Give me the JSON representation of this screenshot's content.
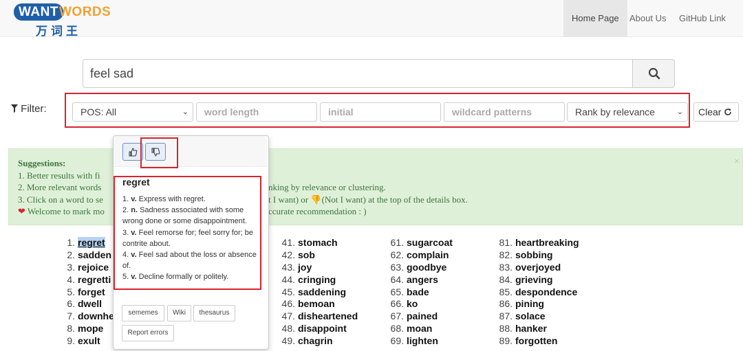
{
  "logo": {
    "want": "WANT",
    "words": "WORDS",
    "cn": "万词王"
  },
  "nav": [
    {
      "label": "Home Page",
      "active": true
    },
    {
      "label": "About Us",
      "active": false
    },
    {
      "label": "GitHub Link",
      "active": false
    }
  ],
  "search": {
    "value": "feel sad",
    "icon": "search-icon"
  },
  "filter": {
    "label": "Filter:",
    "pos_value": "POS: All",
    "word_length_placeholder": "word length",
    "initial_placeholder": "initial",
    "wildcard_placeholder": "wildcard patterns",
    "rank_value": "Rank by relevance",
    "clear_label": "Clear"
  },
  "suggestions": {
    "title": "Suggestions:",
    "lines": [
      "1. Better results with fi",
      "2. More relevant words",
      "3. Click on a word to se",
      "Welcome to mark mo"
    ],
    "right_lines": [
      "",
      "nking by relevance or clustering.",
      "t I want) or 👎(Not I want) at the top of the details box.",
      "ccurate recommendation : )"
    ]
  },
  "results": {
    "col1": [
      {
        "n": "1.",
        "w": "regret"
      },
      {
        "n": "2.",
        "w": "sadden"
      },
      {
        "n": "3.",
        "w": "rejoice"
      },
      {
        "n": "4.",
        "w": "regretti"
      },
      {
        "n": "5.",
        "w": "forget"
      },
      {
        "n": "6.",
        "w": "dwell"
      },
      {
        "n": "7.",
        "w": "downhe"
      },
      {
        "n": "8.",
        "w": "mope"
      },
      {
        "n": "9.",
        "w": "exult"
      }
    ],
    "col3": [
      {
        "n": "41.",
        "w": "stomach"
      },
      {
        "n": "42.",
        "w": "sob"
      },
      {
        "n": "43.",
        "w": "joy"
      },
      {
        "n": "44.",
        "w": "cringing"
      },
      {
        "n": "45.",
        "w": "saddening"
      },
      {
        "n": "46.",
        "w": "bemoan"
      },
      {
        "n": "47.",
        "w": "disheartened"
      },
      {
        "n": "48.",
        "w": "disappoint"
      },
      {
        "n": "49.",
        "w": "chagrin"
      }
    ],
    "col4": [
      {
        "n": "61.",
        "w": "sugarcoat"
      },
      {
        "n": "62.",
        "w": "complain"
      },
      {
        "n": "63.",
        "w": "goodbye"
      },
      {
        "n": "64.",
        "w": "angers"
      },
      {
        "n": "65.",
        "w": "bade"
      },
      {
        "n": "66.",
        "w": "ko"
      },
      {
        "n": "67.",
        "w": "pained"
      },
      {
        "n": "68.",
        "w": "moan"
      },
      {
        "n": "69.",
        "w": "lighten"
      }
    ],
    "col5": [
      {
        "n": "81.",
        "w": "heartbreaking"
      },
      {
        "n": "82.",
        "w": "sobbing"
      },
      {
        "n": "83.",
        "w": "overjoyed"
      },
      {
        "n": "84.",
        "w": "grieving"
      },
      {
        "n": "85.",
        "w": "despondence"
      },
      {
        "n": "86.",
        "w": "pining"
      },
      {
        "n": "87.",
        "w": "solace"
      },
      {
        "n": "88.",
        "w": "hanker"
      },
      {
        "n": "89.",
        "w": "forgotten"
      }
    ]
  },
  "popover": {
    "word": "regret",
    "definitions": [
      {
        "n": "1.",
        "pos": "v.",
        "text": "Express with regret."
      },
      {
        "n": "2.",
        "pos": "n.",
        "text": "Sadness associated with some wrong done or some disappointment."
      },
      {
        "n": "3.",
        "pos": "v.",
        "text": "Feel remorse for; feel sorry for; be contrite about."
      },
      {
        "n": "4.",
        "pos": "v.",
        "text": "Feel sad about the loss or absence of."
      },
      {
        "n": "5.",
        "pos": "v.",
        "text": "Decline formally or politely."
      }
    ],
    "buttons": {
      "sememes": "sememes",
      "wiki": "Wiki",
      "thesaurus": "thesaurus",
      "report": "Report errors"
    }
  },
  "colors": {
    "brand_blue": "#1f5faa",
    "brand_orange": "#f2a230",
    "annotation_red": "#d9232c",
    "suggestion_bg": "#dff0d8"
  }
}
